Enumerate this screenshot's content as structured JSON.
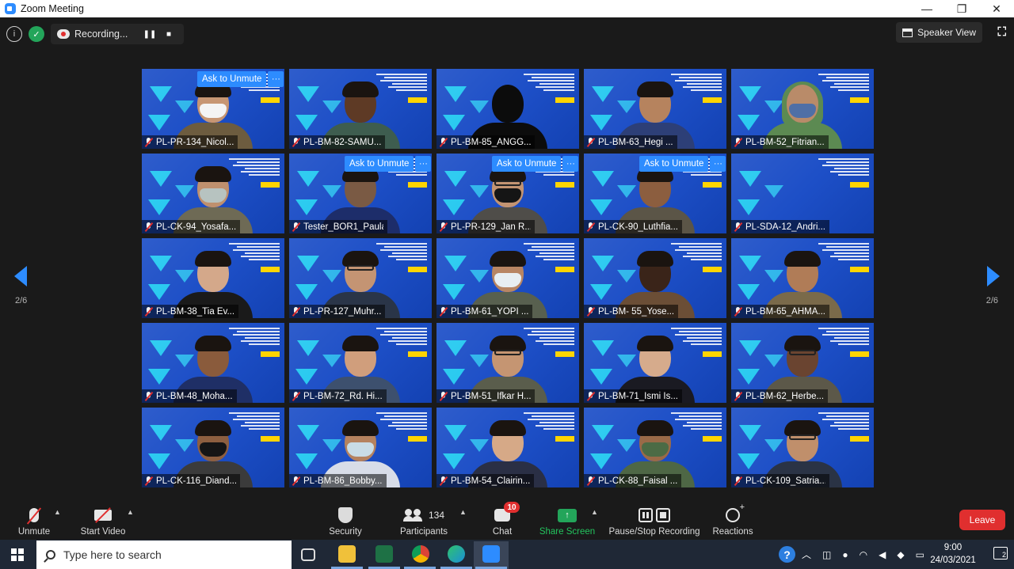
{
  "window": {
    "title": "Zoom Meeting",
    "minimize": "—",
    "maximize": "❐",
    "close": "✕"
  },
  "topbar": {
    "info_icon": "i",
    "shield_icon": "✓",
    "recording_label": "Recording...",
    "speaker_view_label": "Speaker View"
  },
  "pagination": {
    "left_indicator": "2/6",
    "right_indicator": "2/6"
  },
  "ask_to_unmute": "Ask to Unmute",
  "more_icon": "···",
  "participants": [
    {
      "name": "PL-PR-134_Nicol...",
      "ask_unmute": true,
      "skin": "#c79673",
      "mask": "#f4f4f4",
      "glasses": false,
      "shirt": "#6d5c3f",
      "hijab": false
    },
    {
      "name": "PL-BM-82-SAMU...",
      "ask_unmute": false,
      "skin": "#5e3a25",
      "mask": "",
      "glasses": false,
      "shirt": "#3e5d4f",
      "hijab": false
    },
    {
      "name": "PL-BM-85_ANGG...",
      "ask_unmute": false,
      "skin": "#0c0c0c",
      "mask": "",
      "glasses": false,
      "shirt": "#0c0c0c",
      "hijab": false,
      "silhouette": true
    },
    {
      "name": "PL-BM-63_Hegi ...",
      "ask_unmute": false,
      "skin": "#b6835e",
      "mask": "",
      "glasses": false,
      "shirt": "#2d3f77",
      "hijab": false
    },
    {
      "name": "PL-BM-52_Fitrian...",
      "ask_unmute": false,
      "skin": "#b98b69",
      "mask": "#4f6fa6",
      "glasses": false,
      "shirt": "#5c8a52",
      "hijab": true
    },
    {
      "name": "PL-CK-94_Yosafa...",
      "ask_unmute": false,
      "skin": "#bf906e",
      "mask": "#b7c3c0",
      "glasses": false,
      "shirt": "#6e6a55",
      "hijab": false
    },
    {
      "name": "Tester_BOR1_Paula",
      "ask_unmute": true,
      "skin": "#7a5a44",
      "mask": "",
      "glasses": false,
      "shirt": "#1d2d6a",
      "hijab": false
    },
    {
      "name": "PL-PR-129_Jan R...",
      "ask_unmute": true,
      "skin": "#c39472",
      "mask": "#151515",
      "glasses": true,
      "shirt": "#4f4d49",
      "hijab": false
    },
    {
      "name": "PL-CK-90_Luthfia...",
      "ask_unmute": true,
      "skin": "#8c5e3f",
      "mask": "",
      "glasses": false,
      "shirt": "#5b5547",
      "hijab": false
    },
    {
      "name": "PL-SDA-12_Andri...",
      "ask_unmute": false,
      "skin": "#1d4fc7",
      "mask": "",
      "glasses": false,
      "shirt": "#1d4fc7",
      "hijab": false,
      "empty": true
    },
    {
      "name": "PL-BM-38_Tia Ev...",
      "ask_unmute": false,
      "skin": "#d4a88a",
      "mask": "",
      "glasses": false,
      "shirt": "#1a1a1a",
      "hijab": false
    },
    {
      "name": "PL-PR-127_Muhr...",
      "ask_unmute": false,
      "skin": "#c49473",
      "mask": "",
      "glasses": true,
      "shirt": "#2a3548",
      "hijab": false
    },
    {
      "name": "PL-BM-61_YOPI ...",
      "ask_unmute": false,
      "skin": "#b88563",
      "mask": "#e8eef2",
      "glasses": false,
      "shirt": "#58604f",
      "hijab": false
    },
    {
      "name": "PL-BM- 55_Yose...",
      "ask_unmute": false,
      "skin": "#3a2419",
      "mask": "",
      "glasses": false,
      "shirt": "#6b4e36",
      "hijab": false
    },
    {
      "name": "PL-BM-65_AHMA...",
      "ask_unmute": false,
      "skin": "#b07c57",
      "mask": "",
      "glasses": false,
      "shirt": "#7a6a4a",
      "hijab": false
    },
    {
      "name": "PL-BM-48_Moha...",
      "ask_unmute": false,
      "skin": "#8a5b3c",
      "mask": "",
      "glasses": false,
      "shirt": "#1f2f66",
      "hijab": false
    },
    {
      "name": "PL-BM-72_Rd. Hi...",
      "ask_unmute": false,
      "skin": "#d09e7c",
      "mask": "",
      "glasses": false,
      "shirt": "#3d506e",
      "hijab": false
    },
    {
      "name": "PL-BM-51_Ifkar H...",
      "ask_unmute": false,
      "skin": "#c59572",
      "mask": "",
      "glasses": true,
      "shirt": "#5a5d4c",
      "hijab": false
    },
    {
      "name": "PL-BM-71_Ismi Is...",
      "ask_unmute": false,
      "skin": "#d6ab8c",
      "mask": "",
      "glasses": false,
      "shirt": "#1a1a22",
      "hijab": false
    },
    {
      "name": "PL-BM-62_Herbe...",
      "ask_unmute": false,
      "skin": "#6a4430",
      "mask": "",
      "glasses": true,
      "shirt": "#5c5849",
      "hijab": false
    },
    {
      "name": "PL-CK-116_Diand...",
      "ask_unmute": false,
      "skin": "#8d5f40",
      "mask": "#151515",
      "glasses": false,
      "shirt": "#3b3b3b",
      "hijab": false
    },
    {
      "name": "PL-BM-86_Bobby...",
      "ask_unmute": false,
      "skin": "#b5825f",
      "mask": "#c9dce6",
      "glasses": false,
      "shirt": "#d8dde8",
      "hijab": false
    },
    {
      "name": "PL-BM-54_Clairin...",
      "ask_unmute": false,
      "skin": "#d6a987",
      "mask": "",
      "glasses": false,
      "shirt": "#2a2f45",
      "hijab": false
    },
    {
      "name": "PL-CK-88_Faisal ...",
      "ask_unmute": false,
      "skin": "#9a6a48",
      "mask": "#4c6b45",
      "glasses": false,
      "shirt": "#4e6745",
      "hijab": false
    },
    {
      "name": "PL-CK-109_Satria...",
      "ask_unmute": false,
      "skin": "#c08f6b",
      "mask": "",
      "glasses": true,
      "shirt": "#2a3345",
      "hijab": false
    }
  ],
  "controls": {
    "unmute": "Unmute",
    "start_video": "Start Video",
    "security": "Security",
    "participants": "Participants",
    "participants_count": "134",
    "chat": "Chat",
    "chat_badge": "10",
    "share_screen": "Share Screen",
    "pause_stop_recording": "Pause/Stop Recording",
    "reactions": "Reactions",
    "leave": "Leave"
  },
  "taskbar": {
    "search_placeholder": "Type here to search",
    "time": "9:00",
    "date": "24/03/2021",
    "notification_count": "2",
    "help_icon": "?"
  },
  "colors": {
    "accent": "#2d8cff",
    "danger": "#e02f2f",
    "success": "#23a55a",
    "tile_bg": "#1d4fc7"
  }
}
